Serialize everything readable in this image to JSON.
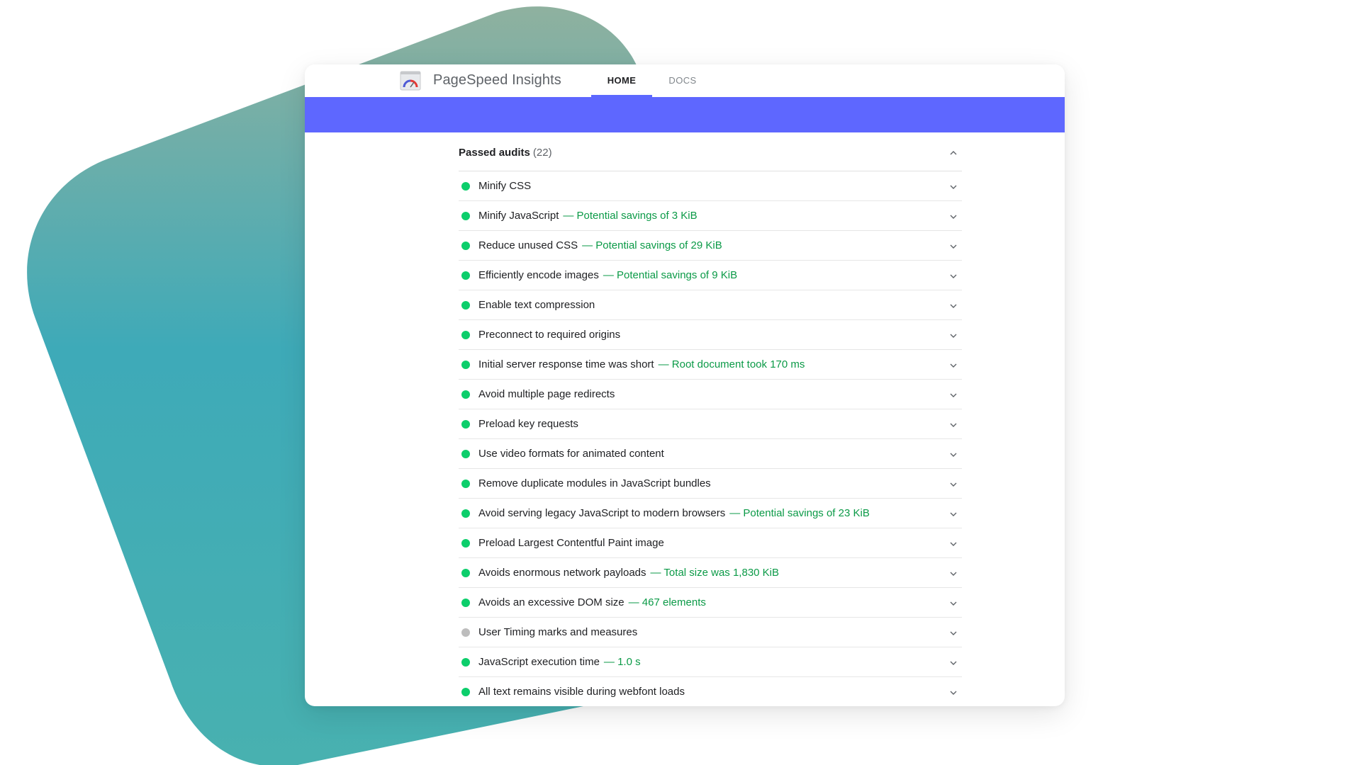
{
  "app": {
    "brand": "PageSpeed Insights",
    "nav": {
      "home": "HOME",
      "docs": "DOCS"
    },
    "colors": {
      "banner": "#5e67ff",
      "pass": "#0cce6b",
      "neutral": "#bdbdbd",
      "detail": "#0b9a47"
    }
  },
  "section": {
    "title": "Passed audits",
    "count": "(22)"
  },
  "audits": [
    {
      "label": "Minify CSS",
      "detail": "",
      "status": "pass"
    },
    {
      "label": "Minify JavaScript",
      "detail": "— Potential savings of 3 KiB",
      "status": "pass"
    },
    {
      "label": "Reduce unused CSS",
      "detail": "— Potential savings of 29 KiB",
      "status": "pass"
    },
    {
      "label": "Efficiently encode images",
      "detail": "— Potential savings of 9 KiB",
      "status": "pass"
    },
    {
      "label": "Enable text compression",
      "detail": "",
      "status": "pass"
    },
    {
      "label": "Preconnect to required origins",
      "detail": "",
      "status": "pass"
    },
    {
      "label": "Initial server response time was short",
      "detail": "— Root document took 170 ms",
      "status": "pass"
    },
    {
      "label": "Avoid multiple page redirects",
      "detail": "",
      "status": "pass"
    },
    {
      "label": "Preload key requests",
      "detail": "",
      "status": "pass"
    },
    {
      "label": "Use video formats for animated content",
      "detail": "",
      "status": "pass"
    },
    {
      "label": "Remove duplicate modules in JavaScript bundles",
      "detail": "",
      "status": "pass"
    },
    {
      "label": "Avoid serving legacy JavaScript to modern browsers",
      "detail": "— Potential savings of 23 KiB",
      "status": "pass"
    },
    {
      "label": "Preload Largest Contentful Paint image",
      "detail": "",
      "status": "pass"
    },
    {
      "label": "Avoids enormous network payloads",
      "detail": "— Total size was 1,830 KiB",
      "status": "pass"
    },
    {
      "label": "Avoids an excessive DOM size",
      "detail": "— 467 elements",
      "status": "pass"
    },
    {
      "label": "User Timing marks and measures",
      "detail": "",
      "status": "neutral"
    },
    {
      "label": "JavaScript execution time",
      "detail": "— 1.0 s",
      "status": "pass"
    },
    {
      "label": "All text remains visible during webfont loads",
      "detail": "",
      "status": "pass"
    }
  ]
}
